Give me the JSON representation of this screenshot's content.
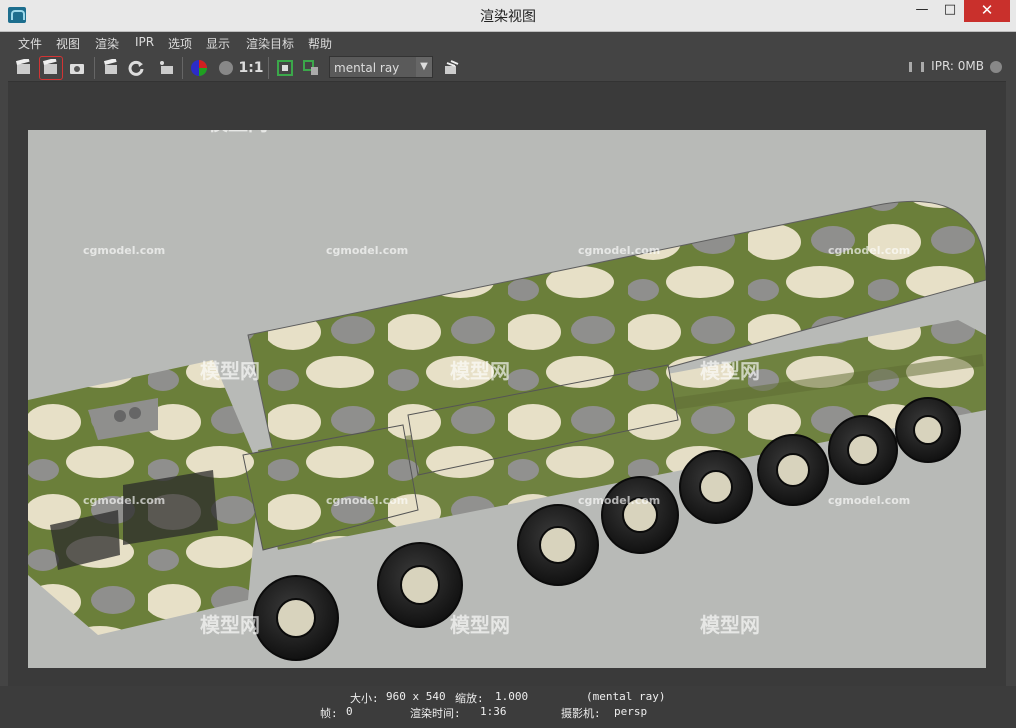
{
  "window": {
    "title": "渲染视图",
    "controls": {
      "minimize": "—",
      "maximize": "□",
      "close": "✕"
    }
  },
  "menu": [
    "文件",
    "视图",
    "渲染",
    "IPR",
    "选项",
    "显示",
    "渲染目标",
    "帮助"
  ],
  "toolbar": {
    "renderer": "mental ray",
    "zoom_label": "1:1",
    "ipr_status": "IPR: 0MB"
  },
  "watermarks": {
    "brand": "模型网",
    "site": "cgmodel.com"
  },
  "status": {
    "line1": {
      "size_label": "大小:",
      "size_value": "960 x 540",
      "zoom_label": "缩放:",
      "zoom_value": "1.000",
      "renderer": "(mental ray)"
    },
    "line2": {
      "frame_label": "帧:",
      "frame_value": "0",
      "time_label": "渲染时间:",
      "time_value": "1:36",
      "camera_label": "摄影机:",
      "camera_value": "persp"
    }
  },
  "colors": {
    "camo_green": "#6b7f3a",
    "camo_cream": "#e7e0c7",
    "camo_gray": "#8f8f8d",
    "render_bg": "#b8bab7"
  },
  "icons": [
    "render-icon",
    "snapshot-icon",
    "camera-icon",
    "ipr-render-icon",
    "refresh-icon",
    "keep-image-icon",
    "color-channels-icon",
    "alpha-channel-icon",
    "real-size-icon",
    "display-region-icon",
    "remove-image-icon",
    "settings-icon"
  ]
}
